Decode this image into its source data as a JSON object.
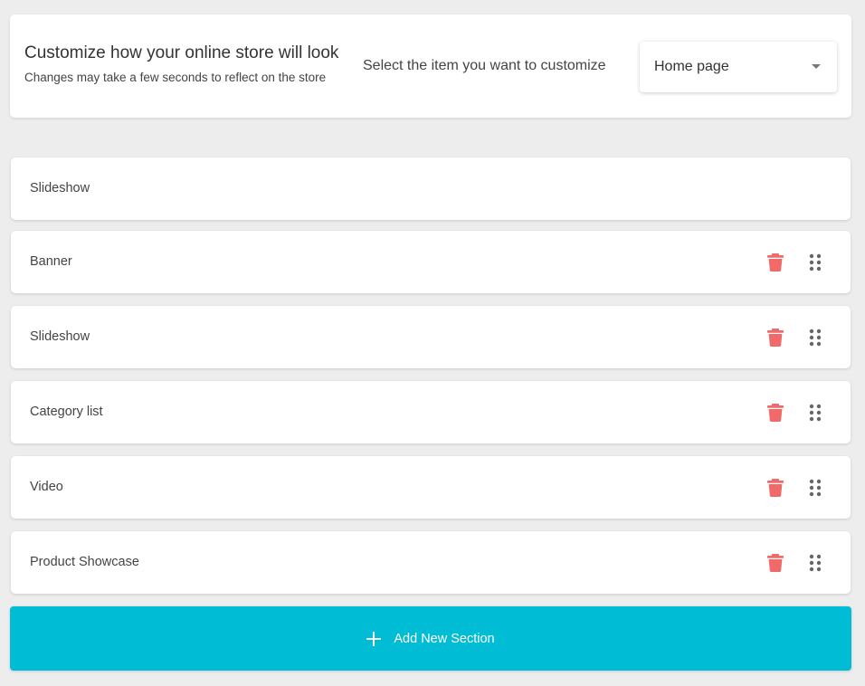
{
  "header": {
    "title": "Customize how your online store will look",
    "subtitle": "Changes may take a few seconds to reflect on the store",
    "select_prompt": "Select the item you want to customize",
    "selected_page": "Home page"
  },
  "sections": [
    {
      "label": "Slideshow",
      "actions": false
    },
    {
      "label": "Banner",
      "actions": true
    },
    {
      "label": "Slideshow",
      "actions": true
    },
    {
      "label": "Category list",
      "actions": true
    },
    {
      "label": "Video",
      "actions": true
    },
    {
      "label": "Product Showcase",
      "actions": true
    }
  ],
  "add_button": {
    "label": "Add New Section",
    "icon": "plus-icon"
  },
  "colors": {
    "accent": "#00bcd4",
    "delete": "#f06a6a",
    "background": "#ededed"
  }
}
